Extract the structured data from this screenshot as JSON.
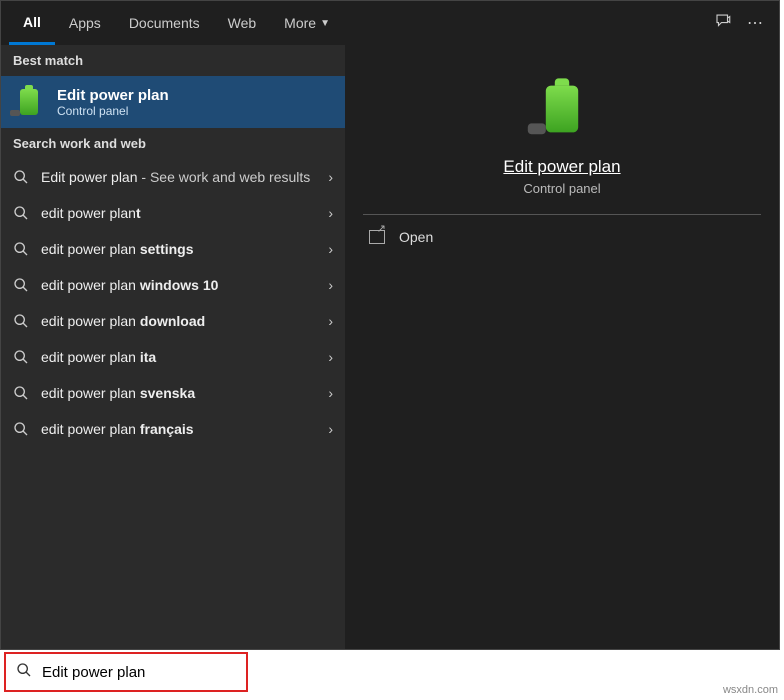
{
  "tabs": {
    "all": "All",
    "apps": "Apps",
    "documents": "Documents",
    "web": "Web",
    "more": "More"
  },
  "sections": {
    "best_match": "Best match",
    "search_work_web": "Search work and web"
  },
  "best": {
    "title": "Edit power plan",
    "subtitle": "Control panel"
  },
  "rows": [
    {
      "prefix": "Edit power plan",
      "suffix": " - ",
      "tail": "See work and web results",
      "bold": ""
    },
    {
      "prefix": "edit power plan",
      "bold": "t"
    },
    {
      "prefix": "edit power plan ",
      "bold": "settings"
    },
    {
      "prefix": "edit power plan ",
      "bold": "windows 10"
    },
    {
      "prefix": "edit power plan ",
      "bold": "download"
    },
    {
      "prefix": "edit power plan ",
      "bold": "ita"
    },
    {
      "prefix": "edit power plan ",
      "bold": "svenska"
    },
    {
      "prefix": "edit power plan ",
      "bold": "français"
    }
  ],
  "preview": {
    "title": "Edit power plan",
    "subtitle": "Control panel",
    "open": "Open"
  },
  "search": {
    "value": "Edit power plan"
  },
  "watermark": "wsxdn.com"
}
